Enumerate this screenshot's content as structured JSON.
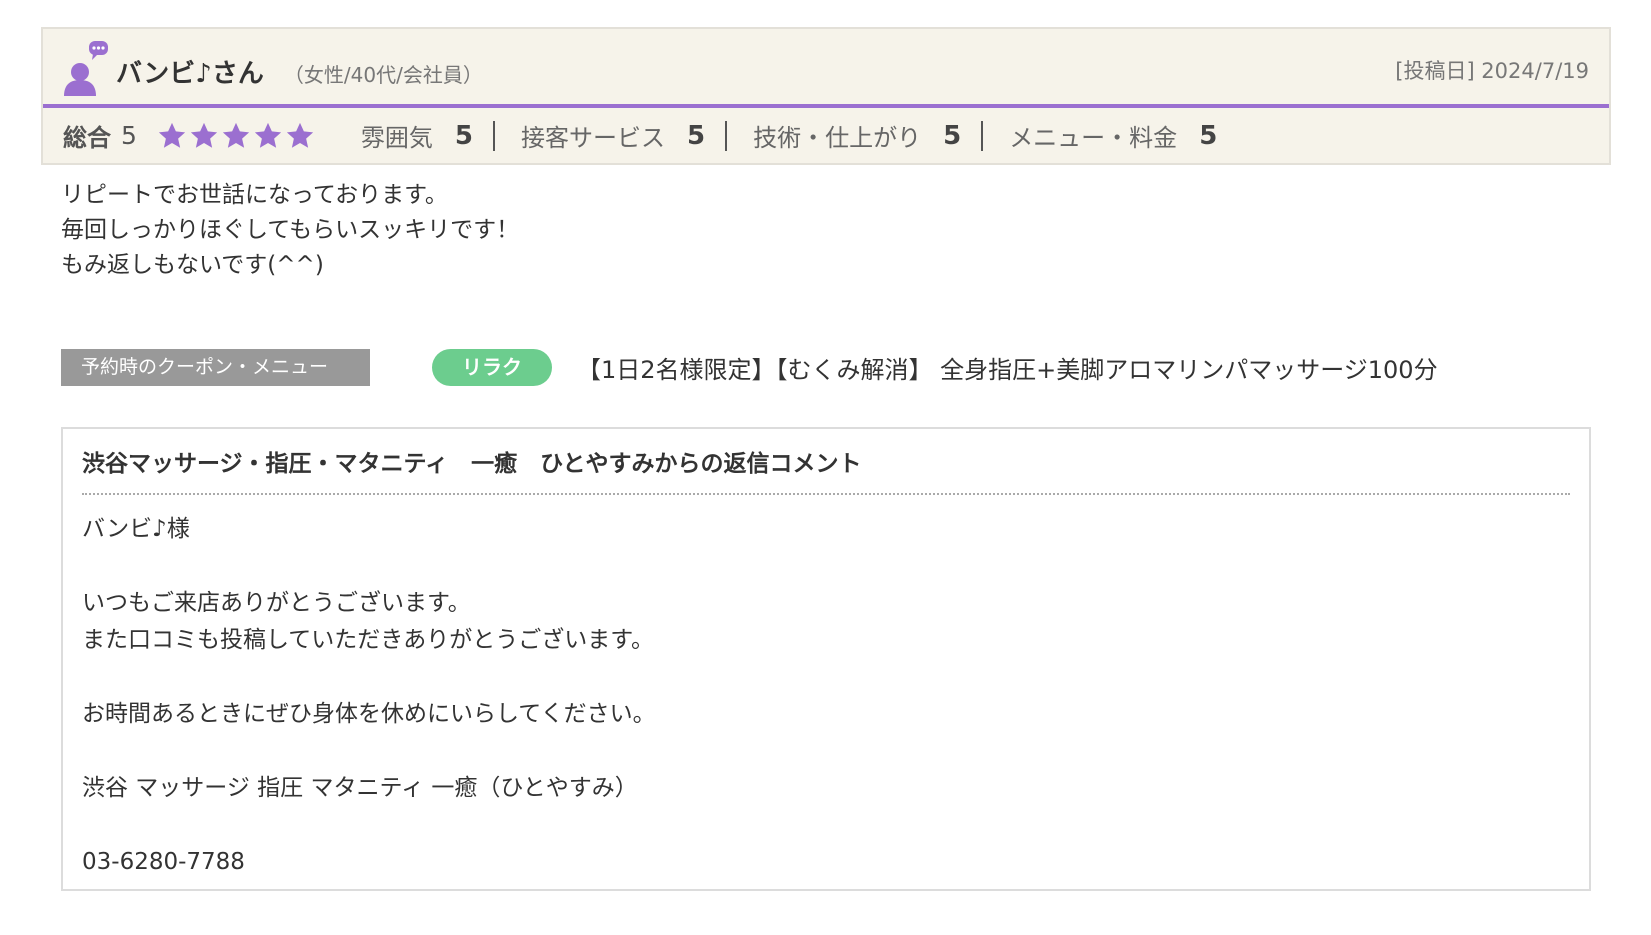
{
  "reviewer": {
    "name": "バンビ♪さん",
    "profile": "（女性/40代/会社員）",
    "post_date": "[投稿日] 2024/7/19"
  },
  "ratings": {
    "overall_label": "総合",
    "overall_value": "5",
    "stars_filled": 5,
    "star_color": "#9b6fd0",
    "accent_color": "#9b6fd0",
    "items": [
      {
        "label": "雰囲気",
        "value": "5"
      },
      {
        "label": "接客サービス",
        "value": "5"
      },
      {
        "label": "技術・仕上がり",
        "value": "5"
      },
      {
        "label": "メニュー・料金",
        "value": "5"
      }
    ]
  },
  "review_text": [
    "リピートでお世話になっております。",
    "毎回しっかりほぐしてもらいスッキリです！",
    "もみ返しもないです(^^)"
  ],
  "coupon": {
    "label": "予約時のクーポン・メニュー",
    "tag": "リラク",
    "tag_color": "#6ccd8e",
    "name": "【1日2名様限定】【むくみ解消】 全身指圧+美脚アロマリンパマッサージ100分"
  },
  "reply": {
    "title": "渋谷マッサージ・指圧・マタニティ　一癒　ひとやすみからの返信コメント",
    "lines": [
      "バンビ♪様",
      "",
      "いつもご来店ありがとうございます。",
      "また口コミも投稿していただきありがとうございます。",
      "",
      "お時間あるときにぜひ身体を休めにいらしてください。",
      "",
      "渋谷 マッサージ 指圧 マタニティ 一癒（ひとやすみ）",
      "",
      "03-6280-7788"
    ]
  },
  "icons": {
    "avatar": "user-comment-icon",
    "star": "star-icon"
  }
}
